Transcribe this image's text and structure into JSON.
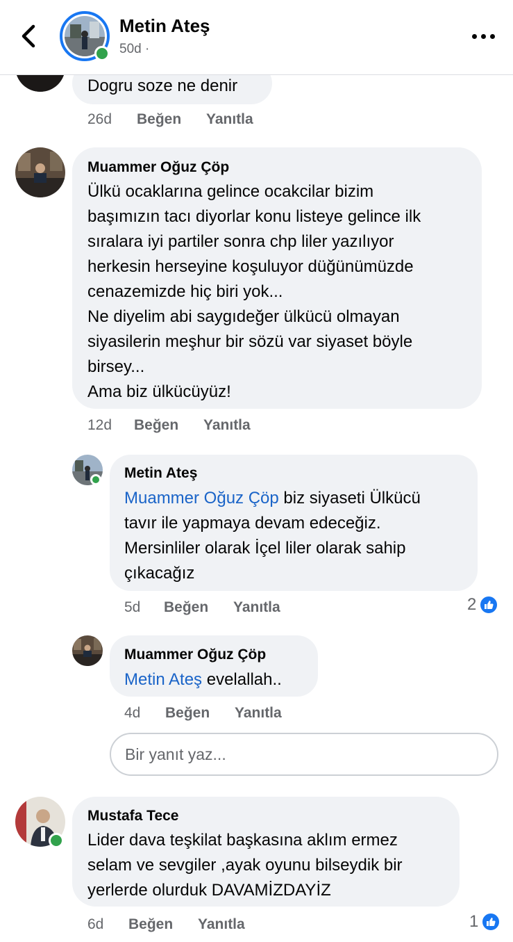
{
  "header": {
    "name": "Metin Ateş",
    "sub": "50d ·",
    "accent": "#1877f2",
    "online_color": "#31a24c"
  },
  "comments": [
    {
      "id": "c0",
      "text_lines": [
        "Dogru soze ne denir"
      ],
      "time": "26d",
      "like_label": "Beğen",
      "reply_label": "Yanıtla"
    },
    {
      "id": "c1",
      "author": "Muammer Oğuz Çöp",
      "text_lines": [
        "Ülkü ocaklarına gelince ocakcilar bizim",
        "başımızın tacı diyorlar konu listeye gelince ilk",
        "sıralara iyi partiler sonra chp liler yazılıyor",
        "herkesin herseyine koşuluyor düğünümüzde",
        "cenazemizde hiç biri yok...",
        "Ne diyelim abi saygıdeğer ülkücü olmayan",
        "siyasilerin meşhur bir sözü var siyaset böyle",
        "birsey...",
        "Ama biz ülkücüyüz!"
      ],
      "time": "12d",
      "like_label": "Beğen",
      "reply_label": "Yanıtla"
    },
    {
      "id": "r1",
      "author": "Metin Ateş",
      "mention": "Muammer Oğuz Çöp",
      "line1_rest": " biz siyaseti Ülkücü",
      "text_lines": [
        "tavır ile yapmaya devam edeceğiz.",
        "Mersinliler olarak İçel liler olarak sahip",
        "çıkacağız"
      ],
      "time": "5d",
      "like_label": "Beğen",
      "reply_label": "Yanıtla",
      "reactions": "2"
    },
    {
      "id": "r2",
      "author": "Muammer Oğuz Çöp",
      "mention": "Metin Ateş",
      "line1_rest": " evelallah..",
      "time": "4d",
      "like_label": "Beğen",
      "reply_label": "Yanıtla"
    },
    {
      "id": "c2",
      "author": "Mustafa Tece",
      "text_lines": [
        "Lider dava teşkilat başkasına aklım ermez",
        "selam ve sevgiler ,ayak oyunu bilseydik bir",
        "yerlerde olurduk DAVAMİZDAYİZ"
      ],
      "time": "6d",
      "like_label": "Beğen",
      "reply_label": "Yanıtla",
      "reactions": "1"
    }
  ],
  "reply_input": {
    "placeholder": "Bir yanıt yaz..."
  },
  "icons": {
    "back": "chevron-left-icon",
    "more": "more-horizontal-icon",
    "like": "thumbs-up-icon"
  }
}
